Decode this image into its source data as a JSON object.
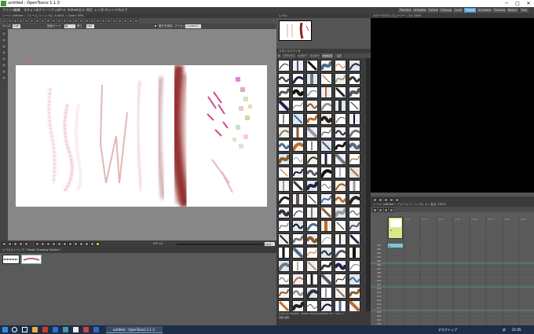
{
  "window": {
    "title": "untitled : OpenToonz 1.1.3",
    "minimize": "─",
    "maximize": "□",
    "close": "✕"
  },
  "menus": [
    "ファイル",
    "編集",
    "スキャン&クリーンアップ",
    "レベル",
    "Xsheet",
    "セル",
    "再生",
    "レンダー",
    "ウィンドウ",
    "ヘルプ"
  ],
  "rooms": [
    "Timeline",
    "Animation",
    "Xsheet",
    "Cleanup",
    "Level",
    "Palette",
    "Animation",
    "Drawing",
    "Basics",
    "Test"
  ],
  "active_room": "Palette",
  "viewer": {
    "title": "シーン: untitled  ::  フレーム: 1  ::  レベル: A.0001  ::  Zoom: 39%",
    "options": {
      "size_label": "サイズ",
      "size_value": "4.00",
      "mode_label": "描画モード",
      "mode_value": "線",
      "hardness_label": "硬さ",
      "hardness_value": "100",
      "pressure_label": "筆圧を使用",
      "preset_label": "プリセット",
      "preset_value": "<custom>"
    },
    "frame_label": "0001"
  },
  "playback": {
    "fps_label": "FPS",
    "fps_value": "24",
    "frame_value": "0001"
  },
  "level_strip": {
    "title": "レベルストリップ : Raster Drawing Palette *"
  },
  "navigator": {
    "title": "レベル..."
  },
  "style_editor": {
    "title": "スタイルエディタ",
    "tabs": [
      "色",
      "テクスチャ",
      "ベクター",
      "ラスター",
      "MyPaint",
      "設定"
    ],
    "active_tab": "MyPaint",
    "footer_line1": "[スタイル]  Palette : Raster Drawing Palette  #1 : color_1",
    "footer_line2": "自動 適用"
  },
  "combo_viewer": {
    "title": "カラーモデル / ビューアー : 1/1 100%"
  },
  "xsheet": {
    "title": "シーン: untitled  ::  フレーム: 1  ::  レベル: A  ::  拡大: 100%",
    "columns": [
      "Col1",
      "Col2",
      "Col3",
      "Col4",
      "Col5",
      "Col6",
      "Col7",
      "Col8",
      "Col9"
    ],
    "level_name": "A",
    "rows": [
      "001",
      "002",
      "003",
      "004",
      "005",
      "006",
      "007",
      "008",
      "009",
      "010",
      "011",
      "012",
      "013",
      "014",
      "015",
      "016",
      "017",
      "018",
      "019",
      "020",
      "021",
      "022"
    ]
  },
  "taskbar": {
    "app_task": "untitled : OpenToonz 1.1.3",
    "tray_text": "デスクトップ",
    "time": "21:05",
    "lang": "あ"
  }
}
